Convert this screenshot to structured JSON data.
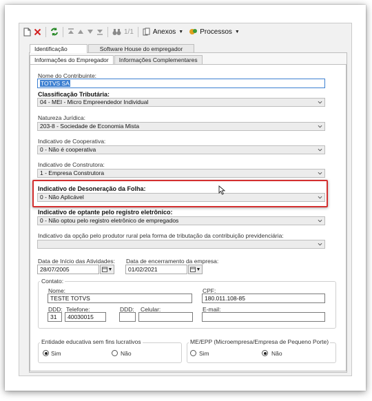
{
  "toolbar": {
    "pager": "1/1",
    "anexos_label": "Anexos",
    "processos_label": "Processos"
  },
  "tabs_top": [
    "Identificação",
    "Software House do empregador"
  ],
  "tabs_sub": [
    "Informações do Empregador",
    "Informações Complementares"
  ],
  "form": {
    "nome_label": "Nome do Contribuinte:",
    "nome_value": "TOTVS SA",
    "classificacao_label": "Classificação Tributária:",
    "classificacao_value": "04 - MEI - Micro Empreendedor Individual",
    "natureza_label": "Natureza Jurídica:",
    "natureza_value": "203-8 - Sociedade de Economia Mista",
    "cooperativa_label": "Indicativo de Cooperativa:",
    "cooperativa_value": "0 - Não é cooperativa",
    "construtora_label": "Indicativo de Construtora:",
    "construtora_value": "1 - Empresa Construtora",
    "desoneracao_label": "Indicativo de Desoneração da Folha:",
    "desoneracao_value": "0 - Não Aplicável",
    "optante_label": "Indicativo de optante pelo registro eletrônico:",
    "optante_value": "0 - Não optou pelo registro eletrônico de empregados",
    "produtor_label": "Indicativo da opção pelo produtor rural pela forma de tributação da contribuição previdenciária:",
    "produtor_value": "",
    "data_inicio_label": "Data de Início das Atividades:",
    "data_inicio_value": "28/07/2005",
    "data_encerramento_label": "Data de encerramento da empresa:",
    "data_encerramento_value": "01/02/2021"
  },
  "contato": {
    "legend": "Contato:",
    "nome_label": "Nome:",
    "nome_value": "TESTE TOTVS",
    "cpf_label": "CPF:",
    "cpf_value": "180.011.108-85",
    "ddd_label": "DDD:",
    "ddd_value": "31",
    "telefone_label": "Telefone:",
    "telefone_value": "40030015",
    "ddd2_label": "DDD:",
    "ddd2_value": "",
    "celular_label": "Celular:",
    "celular_value": "",
    "email_label": "E-mail:",
    "email_value": ""
  },
  "entidade": {
    "legend": "Entidade educativa sem fins lucrativos",
    "sim": "Sim",
    "nao": "Não",
    "selected": "Sim"
  },
  "meepp": {
    "legend": "ME/EPP (Microempresa/Empresa de Pequeno Porte)",
    "sim": "Sim",
    "nao": "Não",
    "selected": "Não"
  },
  "colors": {
    "highlight_border": "#d32f2f",
    "selection": "#3b7fd1"
  }
}
